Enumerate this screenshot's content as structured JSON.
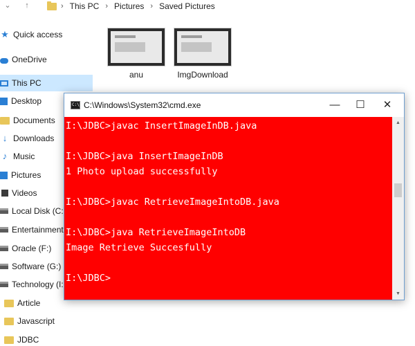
{
  "breadcrumb": [
    "This PC",
    "Pictures",
    "Saved Pictures"
  ],
  "nav": {
    "quick_access": "Quick access",
    "onedrive": "OneDrive",
    "this_pc": "This PC",
    "desktop": "Desktop",
    "documents": "Documents",
    "downloads": "Downloads",
    "music": "Music",
    "pictures": "Pictures",
    "videos": "Videos",
    "local_disk": "Local Disk (C:)",
    "entertainment": "Entertainment (",
    "oracle": "Oracle (F:)",
    "software": "Software (G:)",
    "technology": "Technology (I:)",
    "article": "Article",
    "javascript": "Javascript",
    "jdbc": "JDBC"
  },
  "files": [
    {
      "name": "anu",
      "icon": "image-thumbnail"
    },
    {
      "name": "ImgDownload",
      "icon": "image-thumbnail"
    }
  ],
  "cmd": {
    "title": "C:\\Windows\\System32\\cmd.exe",
    "background_color": "#ff0000",
    "text_color": "#ffffff",
    "lines": [
      "I:\\JDBC>javac InsertImageInDB.java",
      "I:\\JDBC>java InsertImageInDB",
      "1 Photo upload successfully",
      "I:\\JDBC>javac RetrieveImageIntoDB.java",
      "I:\\JDBC>java RetrieveImageIntoDB",
      "Image Retrieve Succesfully",
      "I:\\JDBC>"
    ]
  },
  "glyphs": {
    "chevron_up": "↑",
    "chevron_down": "⌄",
    "breadcrumb_sep": "›",
    "minimize": "—",
    "maximize": "☐",
    "close": "✕",
    "scroll_up": "▲",
    "scroll_down": "▼"
  }
}
